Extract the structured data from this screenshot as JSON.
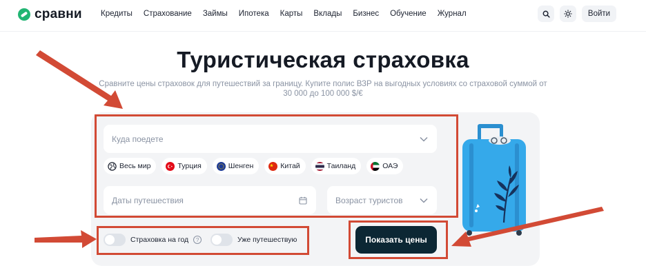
{
  "header": {
    "logo_text": "сравни",
    "nav": [
      "Кредиты",
      "Страхование",
      "Займы",
      "Ипотека",
      "Карты",
      "Вклады",
      "Бизнес",
      "Обучение",
      "Журнал"
    ],
    "search_icon": "search-icon",
    "theme_icon": "sun-icon",
    "login_label": "Войти"
  },
  "hero": {
    "title": "Туристическая страховка",
    "subtitle": "Сравните цены страховок для путешествий за границу. Купите полис ВЗР на выгодных условиях со страховой суммой от 30 000 до 100 000 $/€"
  },
  "form": {
    "destination_placeholder": "Куда поедете",
    "chips": [
      {
        "label": "Весь мир",
        "icon": "globe-icon"
      },
      {
        "label": "Турция",
        "icon": "flag-turkey"
      },
      {
        "label": "Шенген",
        "icon": "flag-eu"
      },
      {
        "label": "Китай",
        "icon": "flag-china"
      },
      {
        "label": "Таиланд",
        "icon": "flag-thailand"
      },
      {
        "label": "ОАЭ",
        "icon": "flag-uae"
      }
    ],
    "dates_placeholder": "Даты путешествия",
    "age_placeholder": "Возраст туристов",
    "toggle_year_label": "Страховка на год",
    "toggle_traveling_label": "Уже путешествую",
    "submit_label": "Показать цены"
  },
  "colors": {
    "brand_green": "#22b573",
    "button_dark": "#0c2734",
    "annotation_red": "#d24a35",
    "suitcase_blue": "#35a9ea"
  }
}
